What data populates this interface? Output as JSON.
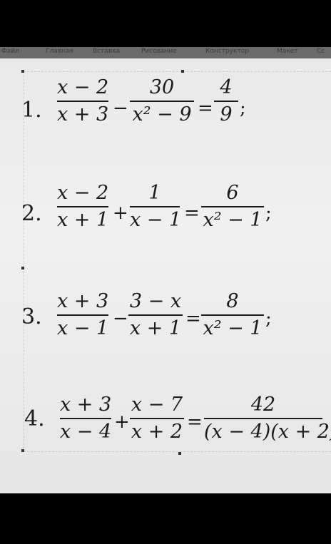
{
  "toolbar": {
    "tabs": [
      "Файл",
      "Главная",
      "Вставка",
      "Рисование",
      "Конструктор",
      "Макет",
      "Сс"
    ]
  },
  "problems": [
    {
      "number": "1.",
      "f1": {
        "num": "x − 2",
        "den": "x + 3"
      },
      "op1": "−",
      "f2": {
        "num": "30",
        "den": "x² − 9"
      },
      "eq": "=",
      "f3": {
        "num": "4",
        "den": "9"
      },
      "end": ";"
    },
    {
      "number": "2.",
      "f1": {
        "num": "x − 2",
        "den": "x + 1"
      },
      "op1": "+",
      "f2": {
        "num": "1",
        "den": "x − 1"
      },
      "eq": "=",
      "f3": {
        "num": "6",
        "den": "x² − 1"
      },
      "end": ";"
    },
    {
      "number": "3.",
      "f1": {
        "num": "x + 3",
        "den": "x − 1"
      },
      "op1": "−",
      "f2": {
        "num": "3 − x",
        "den": "x + 1"
      },
      "eq": "=",
      "f3": {
        "num": "8",
        "den": "x² − 1"
      },
      "end": ";"
    },
    {
      "number": "4.",
      "f1": {
        "num": "x + 3",
        "den": "x − 4"
      },
      "op1": "+",
      "f2": {
        "num": "x − 7",
        "den": "x + 2"
      },
      "eq": "=",
      "f3": {
        "num": "42",
        "den": "(x − 4)(x + 2)"
      },
      "end": "."
    }
  ]
}
